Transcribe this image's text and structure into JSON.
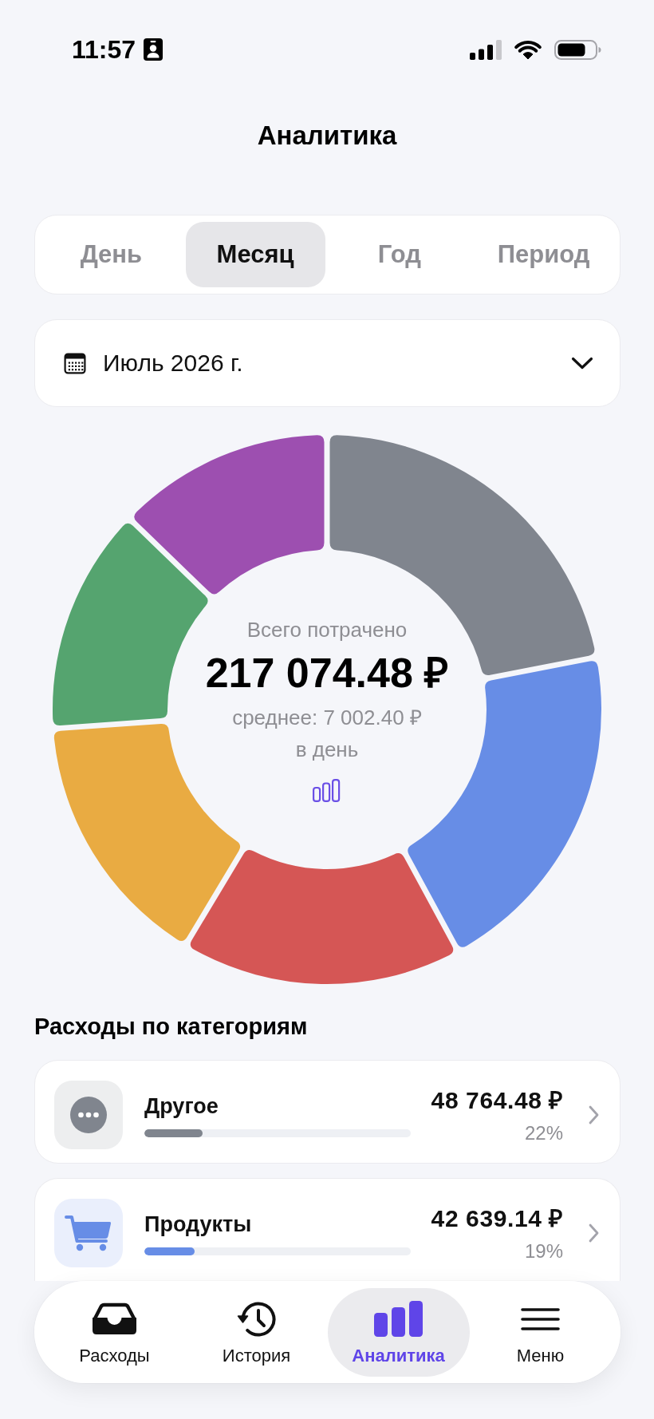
{
  "status_bar": {
    "time": "11:57"
  },
  "title": "Аналитика",
  "period_tabs": [
    {
      "label": "День",
      "selected": false
    },
    {
      "label": "Месяц",
      "selected": true
    },
    {
      "label": "Год",
      "selected": false
    },
    {
      "label": "Период",
      "selected": false
    }
  ],
  "month_picker": {
    "value": "Июль 2026 г."
  },
  "spending_chart": {
    "slices": [
      {
        "color": "#80858e"
      },
      {
        "color": "#678de6"
      },
      {
        "color": "#d55655"
      },
      {
        "color": "#e9ab42"
      },
      {
        "color": "#55a46f"
      },
      {
        "color": "#9d4fb0"
      }
    ],
    "caption": "Всего потрачено",
    "total": "217 074.48 ₽",
    "average": "среднее: 7 002.40 ₽",
    "average_unit": "в день"
  },
  "categories_title": "Расходы по категориям",
  "categories": [
    {
      "name": "Другое",
      "amount": "48 764.48 ₽",
      "percent": "22%",
      "level": 0.22,
      "color": "#80858e"
    },
    {
      "name": "Продукты",
      "amount": "42 639.14 ₽",
      "percent": "19%",
      "level": 0.19,
      "color": "#678de6"
    }
  ],
  "tab_bar": [
    {
      "label": "Расходы",
      "selected": false
    },
    {
      "label": "История",
      "selected": false
    },
    {
      "label": "Аналитика",
      "selected": true
    },
    {
      "label": "Меню",
      "selected": false
    }
  ]
}
